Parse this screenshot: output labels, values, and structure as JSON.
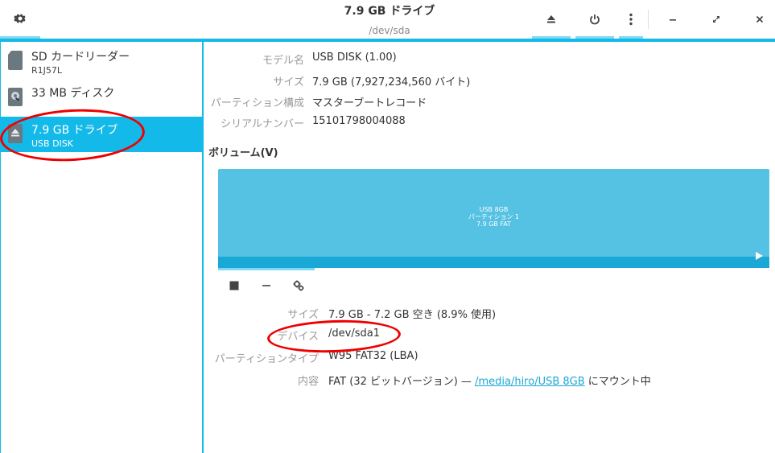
{
  "header": {
    "title": "7.9 GB ドライブ",
    "subtitle": "/dev/sda",
    "icons": [
      "gear-icon",
      "eject-icon",
      "power-icon",
      "more-vert-icon",
      "minimize-icon",
      "maximize-icon",
      "close-icon"
    ]
  },
  "sidebar": {
    "items": [
      {
        "name": "SD カードリーダー",
        "sub": "R1J57L",
        "icon": "sd-card-icon"
      },
      {
        "name": "33 MB ディスク",
        "sub": "",
        "icon": "disk-icon"
      },
      {
        "name": "7.9 GB ドライブ",
        "sub": "USB DISK",
        "icon": "usb-drive-icon"
      }
    ]
  },
  "drive": {
    "model_label": "モデル名",
    "model": "USB DISK (1.00)",
    "size_label": "サイズ",
    "size": "7.9 GB (7,927,234,560 バイト)",
    "partitioning_label": "パーティション構成",
    "partitioning": "マスターブートレコード",
    "serial_label": "シリアルナンバー",
    "serial": "15101798004088"
  },
  "volumes": {
    "title": "ボリューム(V)",
    "block": {
      "line1": "USB 8GB",
      "line2": "パーティション 1",
      "line3": "7.9 GB FAT"
    },
    "toolbar": [
      "stop-icon",
      "minus-icon",
      "gears-icon"
    ]
  },
  "partition": {
    "size_label": "サイズ",
    "size": "7.9 GB - 7.2 GB 空き (8.9% 使用)",
    "device_label": "デバイス",
    "device": "/dev/sda1",
    "type_label": "パーティションタイプ",
    "type": "W95 FAT32 (LBA)",
    "contents_label": "内容",
    "contents_prefix": "FAT (32 ビットバージョン) — ",
    "contents_link": "/media/hiro/USB 8GB",
    "contents_suffix": " にマウント中"
  },
  "colors": {
    "accent": "#13b9e8",
    "volume": "#55c1e3",
    "annotation": "#e00000"
  }
}
